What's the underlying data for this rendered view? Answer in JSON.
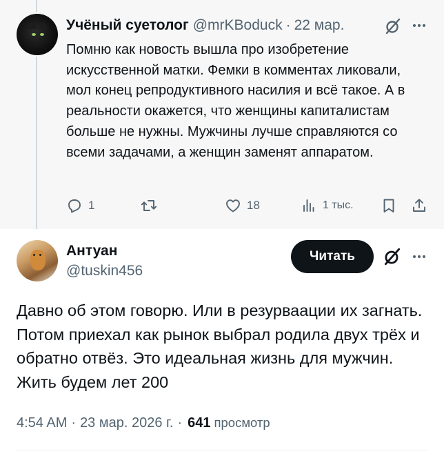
{
  "parent_tweet": {
    "author_name": "Учёный суетолог",
    "author_handle": "@mrKBoduck",
    "separator": "·",
    "date": "22 мар.",
    "text": "Помню как новость вышла про изобретение искусственной матки. Фемки в комментах ликовали, мол конец репродуктивного насилия и всё такое. А в реальности окажется, что женщины капиталистам больше не нужны. Мужчины лучше справляются со всеми задачами, а женщин заменят аппаратом.",
    "actions": {
      "reply_icon": "reply-icon",
      "reply_count": "1",
      "retweet_icon": "retweet-icon",
      "like_icon": "heart-icon",
      "like_count": "18",
      "views_icon": "views-icon",
      "views_count": "1 тыс.",
      "bookmark_icon": "bookmark-icon",
      "share_icon": "share-icon"
    }
  },
  "reply_tweet": {
    "author_name": "Антуан",
    "author_handle": "@tuskin456",
    "follow_label": "Читать",
    "text": "Давно об этом говорю. Или в резурваации их загнать. Потом приехал как рынок выбрал родила двух трёх и обратно отвёз. Это идеальная жизнь для мужчин. Жить будем лет 200",
    "time": "4:54 AM",
    "separator": "·",
    "date": "23 мар. 2026 г.",
    "views_count": "641",
    "views_label": "просмотр"
  },
  "colors": {
    "text_primary": "#0f1419",
    "text_secondary": "#536471",
    "parent_background": "#f7f7f7",
    "button_background": "#0f1419",
    "button_text": "#ffffff"
  }
}
